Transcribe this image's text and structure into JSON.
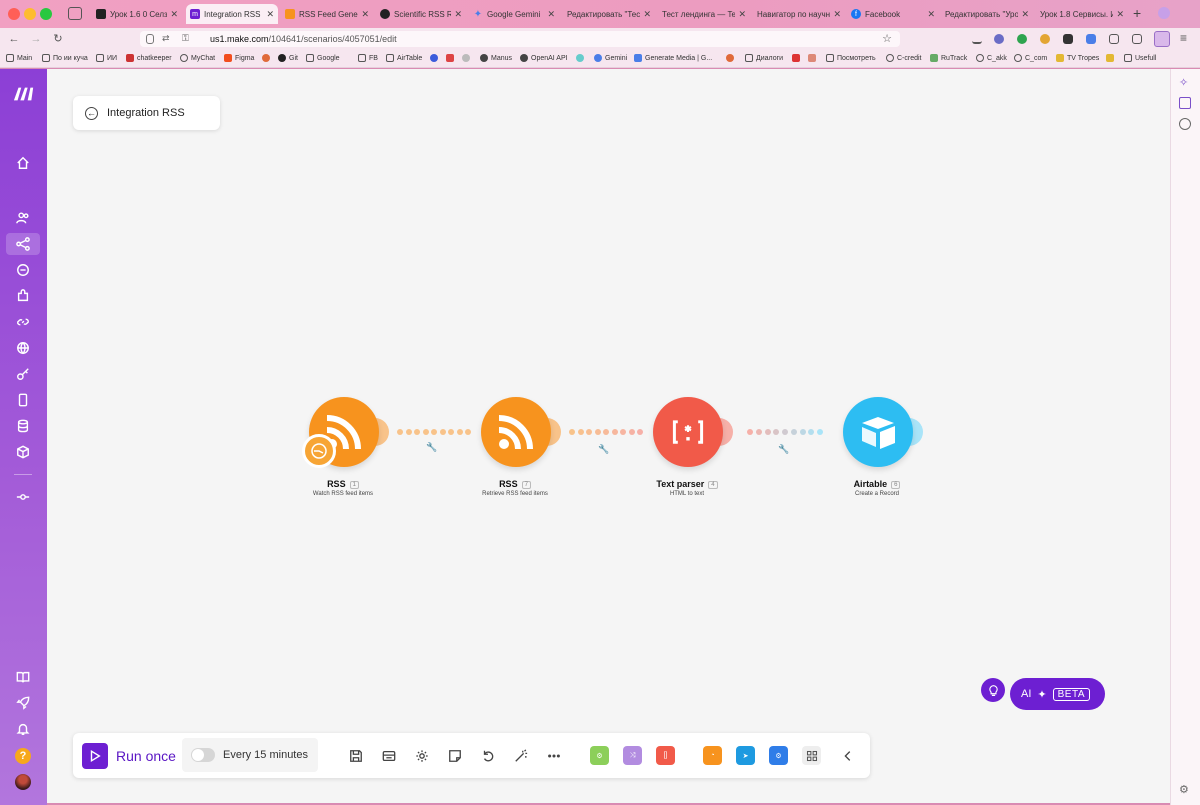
{
  "browser": {
    "tabs": [
      {
        "title": "Урок 1.6 0 Селз, с",
        "fav_color": "#222"
      },
      {
        "title": "Integration RSS | M",
        "fav_color": "#6d1fd2",
        "active": true
      },
      {
        "title": "RSS Feed Generat",
        "fav_color": "#f7931e"
      },
      {
        "title": "Scientific RSS Rea",
        "fav_color": "#222"
      },
      {
        "title": "Google Gemini",
        "fav_color": "#4a7ee8"
      },
      {
        "title": "Редактировать \"Тест",
        "fav_color": "#999"
      },
      {
        "title": "Тест лендинга — Teor",
        "fav_color": "#999"
      },
      {
        "title": "Навигатор по научны",
        "fav_color": "#999"
      },
      {
        "title": "Facebook",
        "fav_color": "#1877f2"
      },
      {
        "title": "Редактировать \"Урок",
        "fav_color": "#999"
      },
      {
        "title": "Урок 1.8 Сервисы. Ин",
        "fav_color": "#999"
      }
    ],
    "url_host": "us1.make.com",
    "url_path": "/104641/scenarios/4057051/edit",
    "bookmarks": [
      "Main",
      "По ии куча",
      "ИИ",
      "chatkeeper",
      "MyChat",
      "Figma",
      "Git",
      "Google",
      "FB",
      "AirTable",
      "Manus",
      "OpenAI API",
      "Gemini",
      "Generate Media | G...",
      "Диалоги",
      "Посмотреть",
      "C-credit",
      "RuTrack",
      "C_akk",
      "C_com",
      "TV Tropes",
      "Usefull"
    ]
  },
  "scenario": {
    "back_label": "Integration RSS",
    "modules": [
      {
        "name": "RSS",
        "number": "1",
        "subtitle": "Watch RSS feed items",
        "color": "#f7931e"
      },
      {
        "name": "RSS",
        "number": "7",
        "subtitle": "Retrieve RSS feed items",
        "color": "#f7931e"
      },
      {
        "name": "Text parser",
        "number": "4",
        "subtitle": "HTML to text",
        "color": "#f15a49"
      },
      {
        "name": "Airtable",
        "number": "6",
        "subtitle": "Create a Record",
        "color": "#2dbdf2"
      }
    ]
  },
  "toolbar": {
    "run_label": "Run once",
    "schedule_label": "Every 15 minutes",
    "tile_colors": [
      "#8ccf5a",
      "#b28ce0",
      "#f15a49",
      "#f7931e",
      "#1e9ae0",
      "#2f7de8"
    ]
  },
  "ai": {
    "label": "AI",
    "badge": "BETA"
  }
}
